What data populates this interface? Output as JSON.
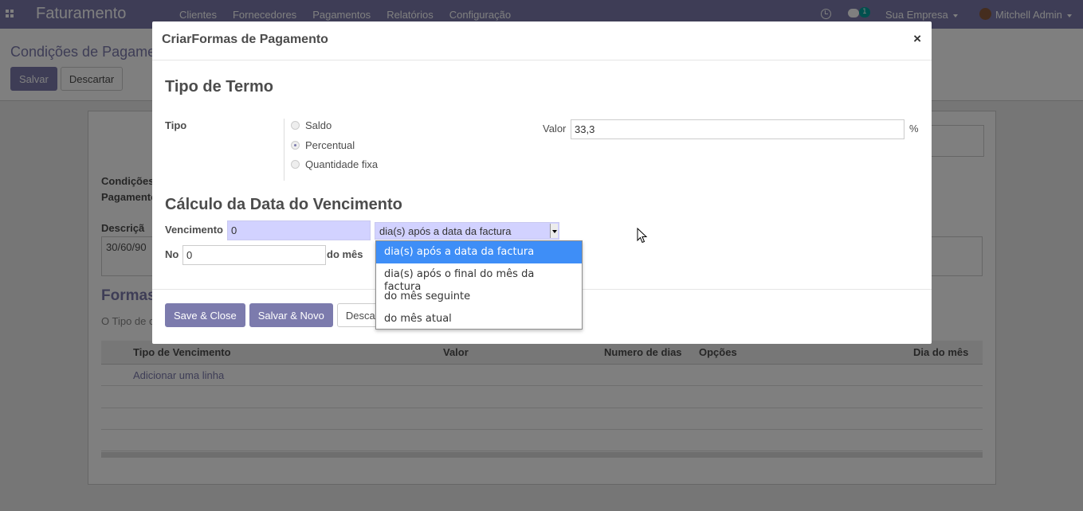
{
  "navbar": {
    "app_name": "Faturamento",
    "menu": [
      "Clientes",
      "Fornecedores",
      "Pagamentos",
      "Relatórios",
      "Configuração"
    ],
    "message_count": "1",
    "company": "Sua Empresa",
    "user": "Mitchell Admin"
  },
  "control_panel": {
    "breadcrumb": "Condições de Pagame",
    "save_label": "Salvar",
    "discard_label": "Descartar"
  },
  "form": {
    "conditions_label_1": "Condições",
    "conditions_label_2": "Pagamento",
    "description_label": "Descriçã",
    "description_value": "30/60/90",
    "section_title": "Formas",
    "section_hint": "O Tipo de c",
    "table_headers": [
      "Tipo de Vencimento",
      "Valor",
      "Numero de dias",
      "Opções",
      "Dia do mês"
    ],
    "add_line": "Adicionar uma linha"
  },
  "modal": {
    "title": "CriarFormas de Pagamento",
    "close_symbol": "×",
    "term_heading": "Tipo de Termo",
    "tipo_label": "Tipo",
    "radio_options": [
      "Saldo",
      "Percentual",
      "Quantidade fixa"
    ],
    "selected_radio": "Percentual",
    "valor_label": "Valor",
    "valor_value": "33,3",
    "percent_symbol": "%",
    "due_heading": "Cálculo da Data do Vencimento",
    "vencimento_label": "Vencimento",
    "vencimento_value": "0",
    "select_value": "dia(s) após a data da factura",
    "no_label": "No",
    "no_value": "0",
    "do_mes_label": "do mês",
    "buttons": {
      "save_close": "Save & Close",
      "save_new": "Salvar & Novo",
      "discard": "Descartar"
    }
  },
  "dropdown": {
    "options": [
      "dia(s) após a data da factura",
      "dia(s) após o final do mês da factura",
      "do mês seguinte",
      "do mês atual"
    ],
    "highlighted_index": 0
  },
  "colors": {
    "brand": "#7c7bad",
    "required_field": "#d2d2ff",
    "dropdown_highlight": "#3e8ef7"
  }
}
